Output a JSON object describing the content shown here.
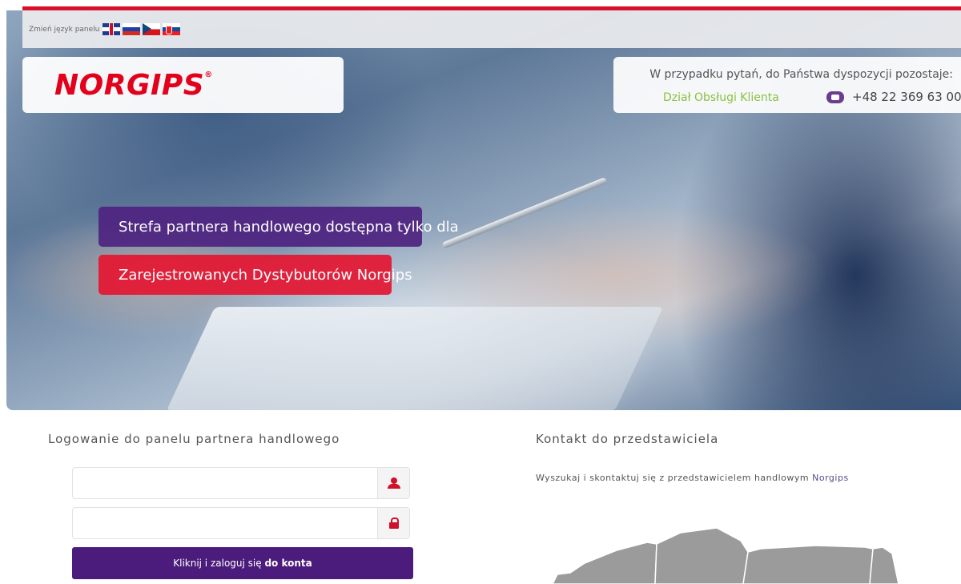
{
  "lang_bar": {
    "label": "Zmień język panelu",
    "flags": [
      "gb-flag-icon",
      "ru-flag-icon",
      "cz-flag-icon",
      "sk-flag-icon"
    ]
  },
  "logo": {
    "text": "NORGIPS",
    "registered": "®"
  },
  "contact_box": {
    "question": "W przypadku pytań, do Państwa dyspozycji pozostaje:",
    "department": "Dział Obsługi Klienta",
    "phone_icon": "phone-icon",
    "phone": "+48 22 369 63 00"
  },
  "hero": {
    "line1": "Strefa partnera handlowego dostępna tylko dla",
    "line2": "Zarejestrowanych Dystybutorów Norgips"
  },
  "login": {
    "title": "Logowanie do panelu partnera handlowego",
    "username_value": "",
    "password_value": "",
    "button_prefix": "Kliknij i zaloguj się ",
    "button_bold": "do konta"
  },
  "contact_rep": {
    "title": "Kontakt do przedstawiciela",
    "subtitle_prefix": "Wyszukaj i skontaktuj się z przedstawicielem handlowym ",
    "subtitle_brand": "Norgips"
  },
  "colors": {
    "accent_red": "#e3001b",
    "purple": "#4b1c7c",
    "green": "#8bc13f"
  }
}
